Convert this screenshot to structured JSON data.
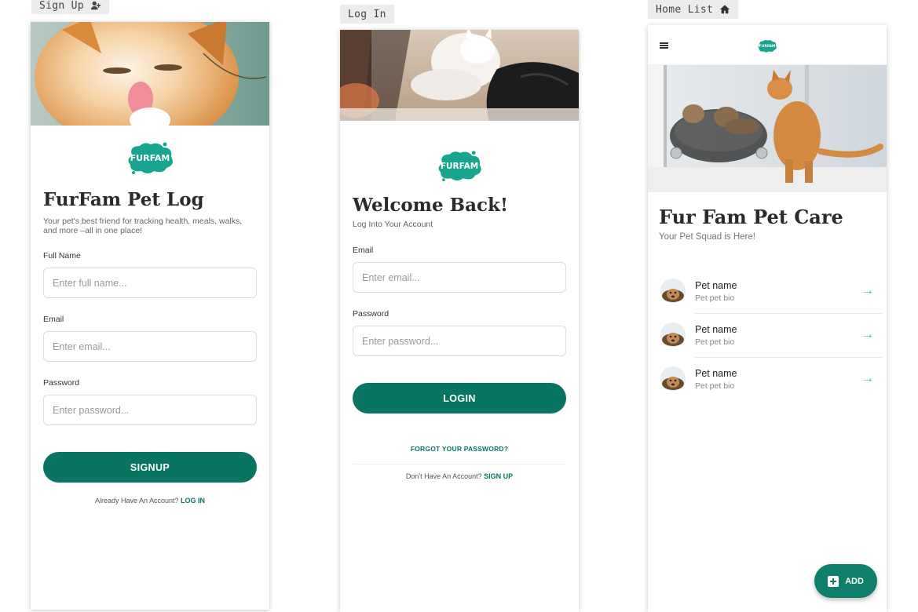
{
  "tags": {
    "signup": "Sign Up",
    "login": "Log In",
    "home": "Home List"
  },
  "brand": {
    "logo_text": "FURFAM",
    "accent": "#0a7463",
    "accent_light": "#27b59f"
  },
  "signup": {
    "title": "FurFam Pet Log",
    "subtitle": "Your pet's best friend for tracking health, meals, walks, and more –all in one place!",
    "name_label": "Full Name",
    "name_placeholder": "Enter full name...",
    "email_label": "Email",
    "email_placeholder": "Enter email...",
    "password_label": "Password",
    "password_placeholder": "Enter password...",
    "button": "SIGNUP",
    "footer_text": "Already Have An Account?",
    "footer_link": "LOG IN"
  },
  "login": {
    "title": "Welcome Back!",
    "subtitle": "Log Into Your Account",
    "email_label": "Email",
    "email_placeholder": "Enter email...",
    "password_label": "Password",
    "password_placeholder": "Enter password...",
    "button": "LOGIN",
    "forgot": "FORGOT YOUR PASSWORD?",
    "footer_text": "Don't Have An Account?",
    "footer_link": "SIGN UP"
  },
  "home": {
    "menu_icon": "hamburger-icon",
    "title": "Fur Fam Pet Care",
    "subtitle": "Your Pet Squad is Here!",
    "pets": [
      {
        "name": "Pet name",
        "bio": "Pet pet bio"
      },
      {
        "name": "Pet name",
        "bio": "Pet pet bio"
      },
      {
        "name": "Pet name",
        "bio": "Pet pet bio"
      }
    ],
    "fab_label": "ADD"
  }
}
